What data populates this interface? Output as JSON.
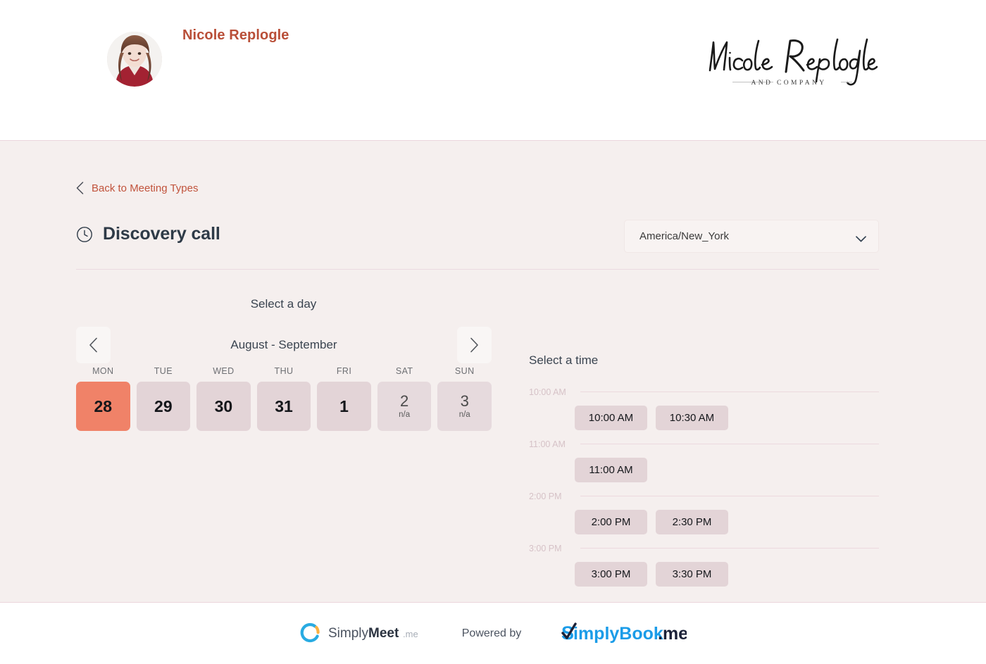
{
  "header": {
    "provider_name": "Nicole Replogle",
    "avatar_alt": "Nicole Replogle profile photo",
    "brand_script": "Nicole Replogle",
    "brand_subtitle": "AND COMPANY"
  },
  "nav": {
    "back_label": "Back to Meeting Types"
  },
  "meeting": {
    "title": "Discovery call",
    "timezone_value": "America/New_York"
  },
  "calendar": {
    "select_day_label": "Select a day",
    "month_range": "August - September",
    "prev_label": "Previous week",
    "next_label": "Next week",
    "weekdays": [
      "MON",
      "TUE",
      "WED",
      "THU",
      "FRI",
      "SAT",
      "SUN"
    ],
    "days": [
      {
        "number": "28",
        "state": "selected",
        "note": ""
      },
      {
        "number": "29",
        "state": "available",
        "note": ""
      },
      {
        "number": "30",
        "state": "available",
        "note": ""
      },
      {
        "number": "31",
        "state": "available",
        "note": ""
      },
      {
        "number": "1",
        "state": "available",
        "note": ""
      },
      {
        "number": "2",
        "state": "disabled",
        "note": "n/a"
      },
      {
        "number": "3",
        "state": "disabled",
        "note": "n/a"
      }
    ]
  },
  "times": {
    "select_time_label": "Select a time",
    "groups": [
      {
        "hour_label": "10:00 AM",
        "slots": [
          "10:00 AM",
          "10:30 AM"
        ]
      },
      {
        "hour_label": "11:00 AM",
        "slots": [
          "11:00 AM"
        ]
      },
      {
        "hour_label": "2:00 PM",
        "slots": [
          "2:00 PM",
          "2:30 PM"
        ]
      },
      {
        "hour_label": "3:00 PM",
        "slots": [
          "3:00 PM",
          "3:30 PM"
        ]
      }
    ]
  },
  "footer": {
    "simplymeet_light": "Simply",
    "simplymeet_bold": "Meet",
    "simplymeet_suffix": ".me",
    "powered_by": "Powered by",
    "simplybook_main": "implyBook",
    "simplybook_suffix": ".me"
  },
  "colors": {
    "accent_selected": "#F08268",
    "day_available": "#E3D4D7",
    "body_background": "#F5EFEE",
    "link": "#C1533C",
    "provider_name": "#B94F38",
    "rule": "#EBD6DD",
    "simplymeet_blue": "#29ABE2",
    "simplymeet_yellow": "#FBB040",
    "simplybook_blue": "#1B9CE8",
    "simplybook_dark": "#1B2138"
  }
}
